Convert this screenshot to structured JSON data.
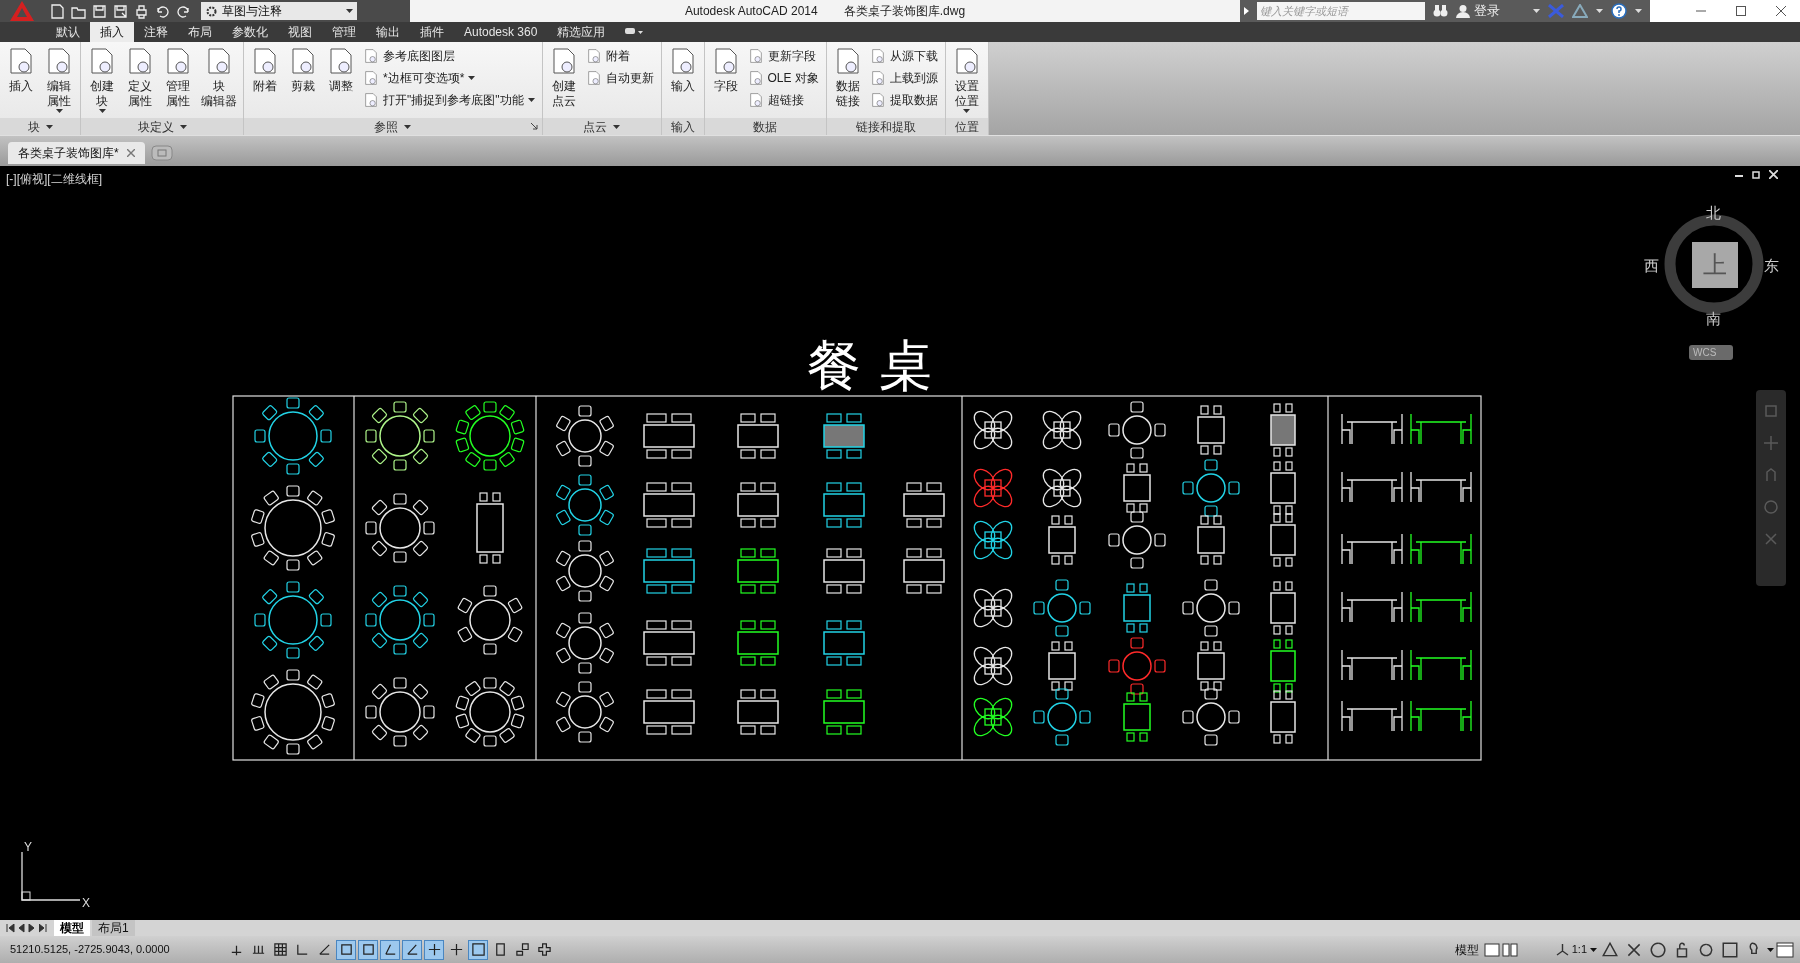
{
  "title_bar": {
    "workspace": "草图与注释",
    "app_title": "Autodesk AutoCAD 2014",
    "file_title": "各类桌子装饰图库.dwg",
    "search": {
      "placeholder": "键入关键字或短语"
    },
    "sign_in": "登录"
  },
  "ribbon_tabs": [
    {
      "label": "默认",
      "selected": false
    },
    {
      "label": "插入",
      "selected": true
    },
    {
      "label": "注释",
      "selected": false
    },
    {
      "label": "布局",
      "selected": false
    },
    {
      "label": "参数化",
      "selected": false
    },
    {
      "label": "视图",
      "selected": false
    },
    {
      "label": "管理",
      "selected": false
    },
    {
      "label": "输出",
      "selected": false
    },
    {
      "label": "插件",
      "selected": false
    },
    {
      "label": "Autodesk 360",
      "selected": false
    },
    {
      "label": "精选应用",
      "selected": false
    }
  ],
  "panels": [
    {
      "title": "块",
      "menu": true,
      "launcher": false,
      "large": [
        {
          "lines": [
            "插入"
          ],
          "dropdown": false
        },
        {
          "lines": [
            "编辑",
            "属性"
          ],
          "dropdown": true
        }
      ]
    },
    {
      "title": "块定义",
      "menu": true,
      "launcher": false,
      "large": [
        {
          "lines": [
            "创建",
            "块"
          ],
          "dropdown": true
        },
        {
          "lines": [
            "定义",
            "属性"
          ],
          "dropdown": false
        },
        {
          "lines": [
            "管理",
            "属性"
          ],
          "dropdown": false
        },
        {
          "lines": [
            "块",
            "编辑器"
          ],
          "dropdown": false
        }
      ]
    },
    {
      "title": "参照",
      "menu": true,
      "launcher": true,
      "large": [
        {
          "lines": [
            "附着"
          ],
          "dropdown": false
        },
        {
          "lines": [
            "剪裁"
          ],
          "dropdown": false
        },
        {
          "lines": [
            "调整"
          ],
          "dropdown": false
        }
      ],
      "small": [
        {
          "label": "参考底图图层",
          "dropdown": false
        },
        {
          "label": "*边框可变选项*",
          "dropdown": true
        },
        {
          "label": "打开\"捕捉到参考底图\"功能",
          "dropdown": true
        }
      ]
    },
    {
      "title": "点云",
      "menu": true,
      "launcher": false,
      "large": [
        {
          "lines": [
            "创建",
            "点云"
          ],
          "dropdown": false
        }
      ],
      "small": [
        {
          "label": "附着",
          "dropdown": false
        },
        {
          "label": "自动更新",
          "dropdown": false
        }
      ]
    },
    {
      "title": "输入",
      "menu": false,
      "launcher": false,
      "large": [
        {
          "lines": [
            "输入"
          ],
          "dropdown": false
        }
      ]
    },
    {
      "title": "数据",
      "menu": false,
      "launcher": false,
      "large": [
        {
          "lines": [
            "字段"
          ],
          "dropdown": false
        }
      ],
      "small": [
        {
          "label": "更新字段",
          "dropdown": false
        },
        {
          "label": "OLE 对象",
          "dropdown": false
        },
        {
          "label": "超链接",
          "dropdown": false
        }
      ]
    },
    {
      "title": "链接和提取",
      "menu": false,
      "launcher": false,
      "large": [
        {
          "lines": [
            "数据",
            "链接"
          ],
          "dropdown": false
        }
      ],
      "small": [
        {
          "label": "从源下载",
          "dropdown": false
        },
        {
          "label": "上载到源",
          "dropdown": false
        },
        {
          "label": "提取数据",
          "dropdown": false
        }
      ]
    },
    {
      "title": "位置",
      "menu": false,
      "launcher": false,
      "large": [
        {
          "lines": [
            "设置",
            "位置"
          ],
          "dropdown": true
        }
      ]
    }
  ],
  "document_tab": {
    "label": "各类桌子装饰图库*"
  },
  "viewport": {
    "label": "[-][俯视][二维线框]",
    "drawing_title": "餐 桌",
    "compass": {
      "north": "北",
      "south": "南",
      "west": "西",
      "east": "东",
      "top": "上",
      "ucs": "WCS"
    },
    "ucs_axes": {
      "y": "Y",
      "x": "X"
    }
  },
  "layout_tabs": [
    {
      "label": "模型",
      "selected": true
    },
    {
      "label": "布局1",
      "selected": false
    }
  ],
  "status_bar": {
    "coordinates": "51210.5125, -2725.9043, 0.0000",
    "toggles": [
      {
        "on": false
      },
      {
        "on": false
      },
      {
        "on": false
      },
      {
        "on": false
      },
      {
        "on": false
      },
      {
        "on": true
      },
      {
        "on": true
      },
      {
        "on": true
      },
      {
        "on": true
      },
      {
        "on": true
      },
      {
        "on": false
      },
      {
        "on": true
      },
      {
        "on": false
      },
      {
        "on": false
      },
      {
        "on": false
      }
    ],
    "space": "模型",
    "scale": "1:1"
  }
}
